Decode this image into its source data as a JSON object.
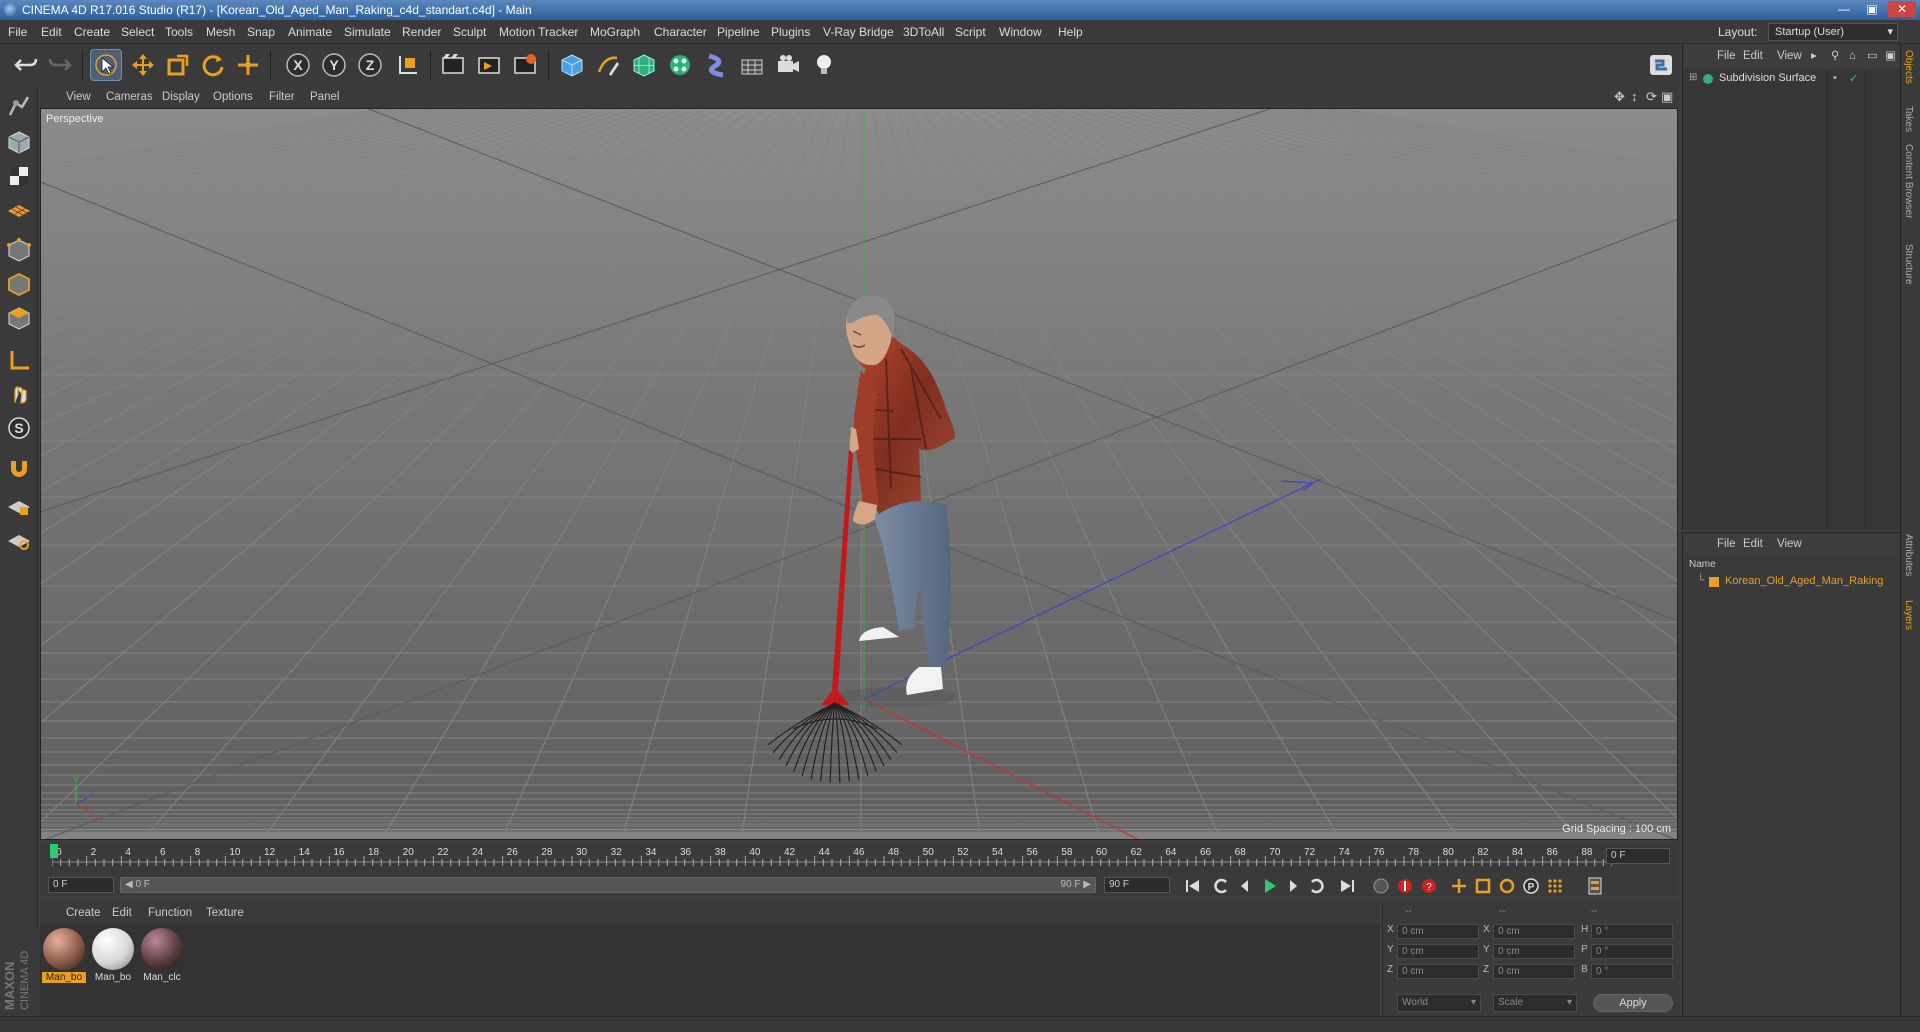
{
  "window": {
    "title": "CINEMA 4D R17.016 Studio (R17) - [Korean_Old_Aged_Man_Raking_c4d_standart.c4d] - Main"
  },
  "menubar": {
    "items": [
      "File",
      "Edit",
      "Create",
      "Select",
      "Tools",
      "Mesh",
      "Snap",
      "Animate",
      "Simulate",
      "Render",
      "Sculpt",
      "Motion Tracker",
      "MoGraph",
      "Character",
      "Pipeline",
      "Plugins",
      "V-Ray Bridge",
      "3DToAll",
      "Script",
      "Window",
      "Help"
    ],
    "layout_label": "Layout:",
    "layout_value": "Startup (User)"
  },
  "toolbar": {
    "icons": [
      "undo-icon",
      "redo-icon",
      "select-arrow-icon",
      "move-icon",
      "scale-icon",
      "rotate-icon",
      "live-select-icon",
      "x-axis-icon",
      "y-axis-icon",
      "z-axis-icon",
      "coordinate-system-icon",
      "render-view-icon",
      "render-picture-viewer-icon",
      "render-settings-icon",
      "cube-icon",
      "pen-spline-icon",
      "subdivision-nurbs-icon",
      "cloner-icon",
      "deformer-icon",
      "floor-icon",
      "camera-icon",
      "light-icon",
      "python-icon"
    ],
    "axis_labels": [
      "X",
      "Y",
      "Z"
    ]
  },
  "viewport": {
    "menu": [
      "View",
      "Cameras",
      "Display",
      "Options",
      "Filter",
      "Panel"
    ],
    "label": "Perspective",
    "grid_spacing": "Grid Spacing : 100 cm"
  },
  "timeline": {
    "ticks": [
      "0",
      "2",
      "4",
      "6",
      "8",
      "10",
      "12",
      "14",
      "16",
      "18",
      "20",
      "22",
      "24",
      "26",
      "28",
      "30",
      "32",
      "34",
      "36",
      "38",
      "40",
      "42",
      "44",
      "46",
      "48",
      "50",
      "52",
      "54",
      "56",
      "58",
      "60",
      "62",
      "64",
      "66",
      "68",
      "70",
      "72",
      "74",
      "76",
      "78",
      "80",
      "82",
      "84",
      "86",
      "88",
      "90"
    ],
    "current_frame": "0 F",
    "start_frame": "0 F",
    "range_start": "0 F",
    "range_end": "90 F",
    "end_frame": "90 F"
  },
  "materials": {
    "menu": [
      "Create",
      "Edit",
      "Function",
      "Texture"
    ],
    "items": [
      {
        "label": "Man_bo",
        "color": "#8a5a48",
        "selected": true
      },
      {
        "label": "Man_bo",
        "color": "#d8d8d8",
        "selected": false
      },
      {
        "label": "Man_clc",
        "color": "#5a3d3d",
        "selected": false
      }
    ]
  },
  "coordinates": {
    "header": [
      "--",
      "--",
      "--"
    ],
    "rows": [
      {
        "a": "X",
        "av": "0 cm",
        "b": "X",
        "bv": "0 cm",
        "c": "H",
        "cv": "0 °"
      },
      {
        "a": "Y",
        "av": "0 cm",
        "b": "Y",
        "bv": "0 cm",
        "c": "P",
        "cv": "0 °"
      },
      {
        "a": "Z",
        "av": "0 cm",
        "b": "Z",
        "bv": "0 cm",
        "c": "B",
        "cv": "0 °"
      }
    ],
    "world": "World",
    "scale": "Scale",
    "apply": "Apply"
  },
  "objects": {
    "menu": [
      "File",
      "Edit",
      "View"
    ],
    "items": [
      {
        "name": "Subdivision Surface"
      }
    ]
  },
  "layers": {
    "menu": [
      "File",
      "Edit",
      "View"
    ],
    "column": "Name",
    "items": [
      {
        "name": "Korean_Old_Aged_Man_Raking",
        "color": "#e8a020"
      }
    ]
  },
  "right_tabs": [
    "Objects",
    "Takes",
    "Content Browser",
    "Structure",
    "Attributes",
    "Layers"
  ],
  "logo": {
    "brand": "MAXON",
    "product": "CINEMA 4D"
  },
  "colors": {
    "accent": "#e8a020",
    "timeline_marker": "#2ecc71",
    "axis_x": "#c03030",
    "axis_y": "#30a030",
    "axis_z": "#3050c0"
  }
}
